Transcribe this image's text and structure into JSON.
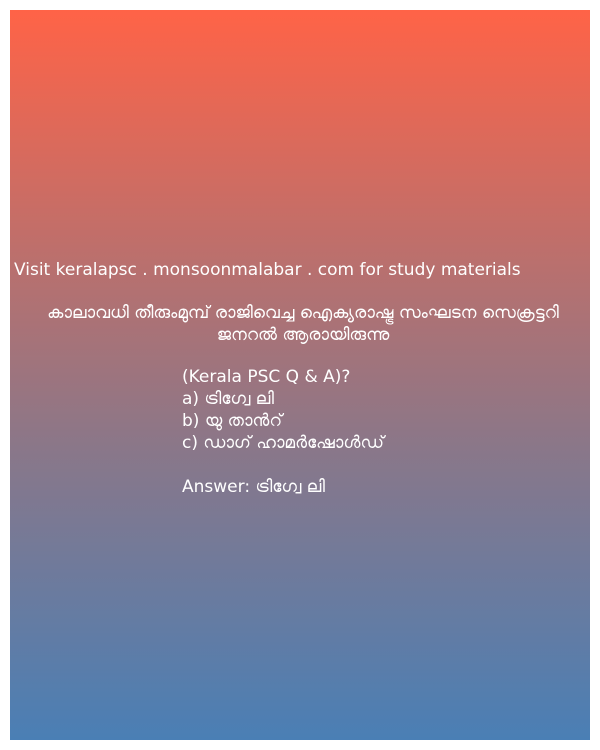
{
  "promo_text": "Visit keralapsc . monsoonmalabar . com for study materials",
  "question": "കാലാവധി തീരുംമുമ്പ് രാജിവെച്ച ഐക്യരാഷ്ട്ര സംഘടന സെക്രട്ടറി ജനറൽ ആരായിരുന്നു",
  "source_tag": "(Kerala PSC Q & A)?",
  "options": [
    "a) ട്രിഗ്വേ ലി",
    "b) യു താൻറ്",
    "c) ഡാഗ് ഹാമർഷോൾഡ്"
  ],
  "answer": "Answer: ട്രിഗ്വേ ലി",
  "colors": {
    "gradient_top": "#ff6347",
    "gradient_bottom": "#4a7fb5",
    "text": "#ffffff"
  }
}
